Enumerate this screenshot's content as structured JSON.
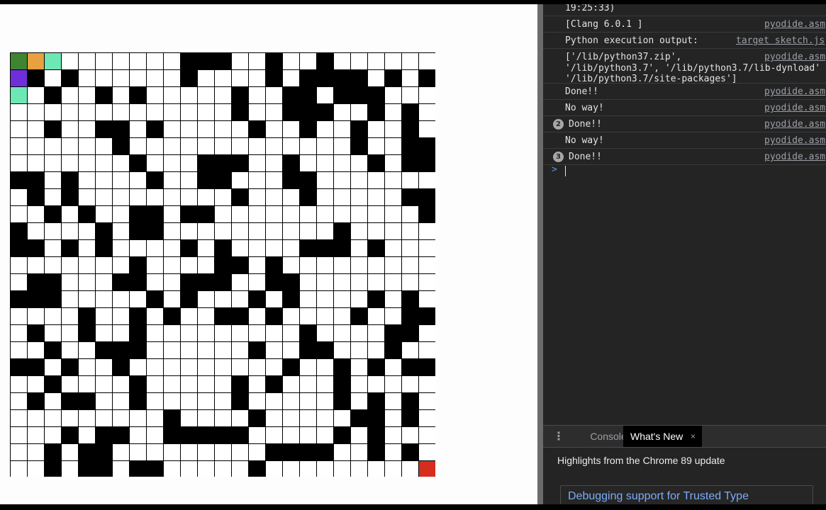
{
  "maze": {
    "rows": 25,
    "cols": 25,
    "walls": [
      "..........###..#..#......",
      ".#.#......#....#.####.#.##",
      "..#..#.#.....#..##.###...",
      ".............#..###..#.#.#",
      "..#..##.#.....#..#..#..#.#",
      "......#.............#..##.",
      ".......#...###..#....#.##",
      "##.#....#..##...##.......",
      ".#.#.........#...#.....##.",
      "..#.#..##.##............##",
      "#....#.##..........#.....",
      "##.#.#....#.#....###.#...",
      ".......#....##.#..........",
      ".##...##..###..##........",
      "###.....#.#...#.#....#.#.",
      "....#..#.#..##.#....#..##",
      ".#..#..#.........#....##.#",
      "..#..###......#..##...#..",
      "##.#..#.........#..#.#.##",
      "..#....#.....#.#...#......",
      ".#.##..#.....#.....#.#.#.",
      ".........#....#.....##.#.#",
      "...#.##..#####.....#.#...",
      "..#.##.........####..#.#.#",
      "..#.##.##.....#.........."
    ],
    "special_cells": [
      {
        "row": 0,
        "col": 0,
        "color": "#3f8430"
      },
      {
        "row": 0,
        "col": 1,
        "color": "#e8a040"
      },
      {
        "row": 0,
        "col": 2,
        "color": "#6de8b4"
      },
      {
        "row": 1,
        "col": 0,
        "color": "#6e2fd8"
      },
      {
        "row": 2,
        "col": 0,
        "color": "#6de8b4"
      },
      {
        "row": 24,
        "col": 24,
        "color": "#d62d1f"
      }
    ]
  },
  "console": {
    "rows": [
      {
        "message": "19:25:33)",
        "source": "",
        "count": ""
      },
      {
        "message": "[Clang 6.0.1 ]",
        "source": "pyodide.asm",
        "count": ""
      },
      {
        "message": "Python execution output:",
        "source": "target sketch.js",
        "count": ""
      },
      {
        "message": "['/lib/python37.zip',\n'/lib/python3.7', '/lib/python3.7/lib-dynload'\n'/lib/python3.7/site-packages']",
        "source": "pyodide.asm",
        "count": ""
      },
      {
        "message": "Done!!",
        "source": "pyodide.asm",
        "count": ""
      },
      {
        "message": "No way!",
        "source": "pyodide.asm",
        "count": ""
      },
      {
        "message": "Done!!",
        "source": "pyodide.asm",
        "count": "2"
      },
      {
        "message": "No way!",
        "source": "pyodide.asm",
        "count": ""
      },
      {
        "message": "Done!!",
        "source": "pyodide.asm",
        "count": "3"
      }
    ],
    "prompt": ">"
  },
  "drawer": {
    "menu_icon": "kebab-menu-icon",
    "tabs": [
      {
        "label": "Console"
      },
      {
        "label": "What's New",
        "close": "×"
      }
    ],
    "highlights": "Highlights from the Chrome 89 update",
    "card_title": "Debugging support for Trusted Type"
  }
}
